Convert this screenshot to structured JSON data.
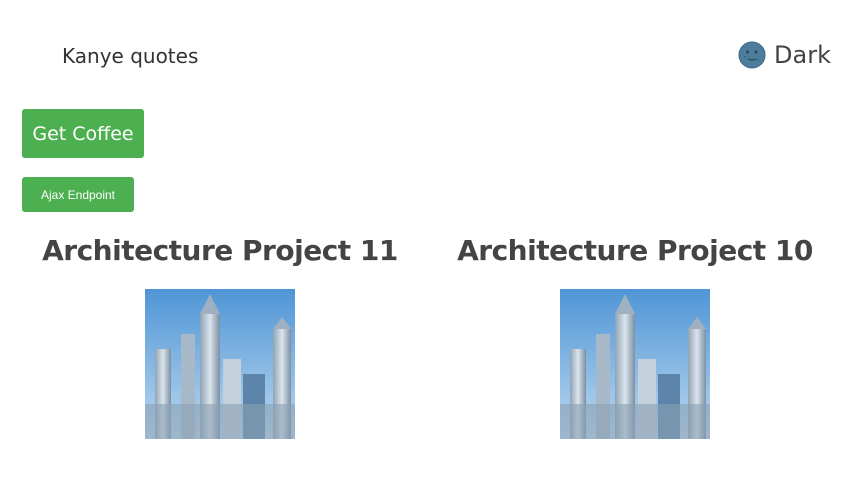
{
  "nav": {
    "link_label": "Kanye quotes"
  },
  "theme_toggle": {
    "icon": "moon-icon",
    "label": "Dark"
  },
  "buttons": {
    "coffee_label": "Get Coffee",
    "ajax_label": "Ajax Endpoint"
  },
  "colors": {
    "button_green": "#4caf50",
    "title_gray": "#444444"
  },
  "projects": [
    {
      "title": "Architecture Project 11",
      "image": "city-skyline-image"
    },
    {
      "title": "Architecture Project 10",
      "image": "city-skyline-image"
    }
  ]
}
